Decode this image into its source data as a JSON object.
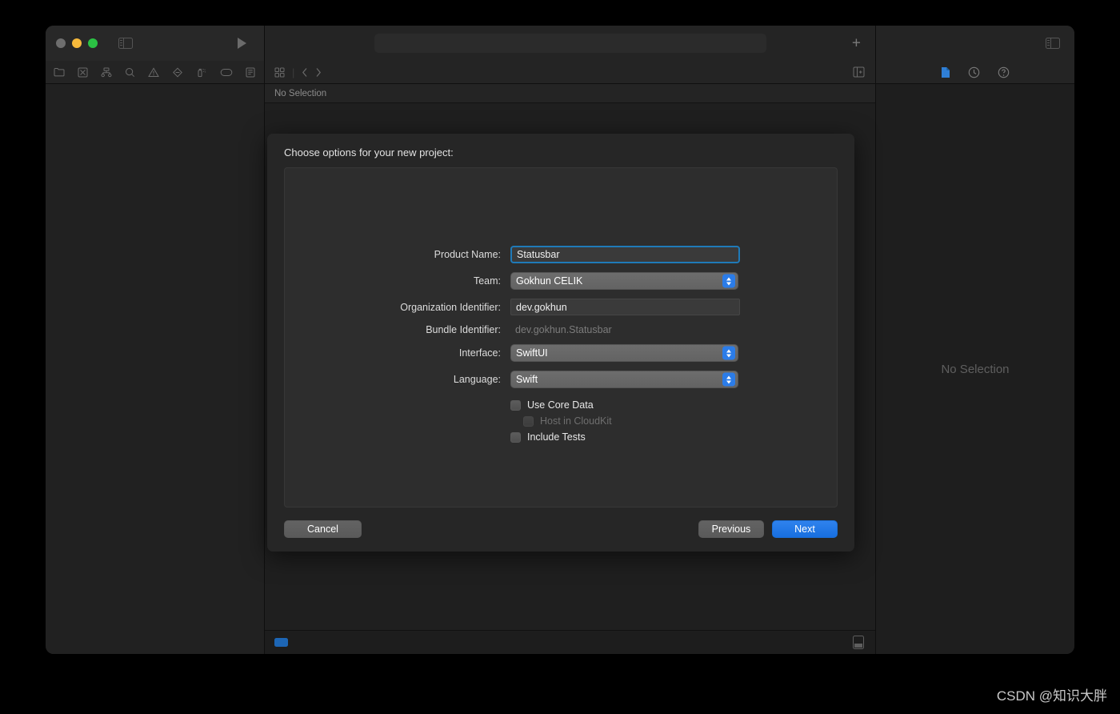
{
  "window": {
    "traffic_lights": [
      "close",
      "minimize",
      "zoom"
    ],
    "run_button": "run-button",
    "sidebar_toggle": "toggle-navigator"
  },
  "toolbar": {
    "add_label": "+",
    "activity_view_placeholder": ""
  },
  "navigator": {
    "icons": [
      "project-navigator-icon",
      "source-control-navigator-icon",
      "symbol-navigator-icon",
      "find-navigator-icon",
      "issue-navigator-icon",
      "test-navigator-icon",
      "debug-navigator-icon",
      "breakpoint-navigator-icon",
      "report-navigator-icon"
    ],
    "filter_toggle": "navigator-filter-toggle"
  },
  "editor": {
    "jump_bar": {
      "related_items_icon": "related-items-icon",
      "back_icon": "chevron-left-icon",
      "forward_icon": "chevron-right-icon",
      "assistant_icon": "assistant-editor-icon"
    },
    "breadcrumb": "No Selection"
  },
  "inspector": {
    "tabs": [
      "file-inspector-icon",
      "history-inspector-icon",
      "quick-help-icon"
    ],
    "empty_state": "No Selection"
  },
  "status_bar": {
    "activity_chip": "build-status-chip",
    "console_toggle": "console-toggle"
  },
  "sheet": {
    "title": "Choose options for your new project:",
    "fields": [
      {
        "label": "Product Name:",
        "value": "Statusbar",
        "kind": "textfield-focused",
        "name": "product-name"
      },
      {
        "label": "Team:",
        "value": "Gokhun CELIK",
        "kind": "popup",
        "name": "team"
      },
      {
        "label": "Organization Identifier:",
        "value": "dev.gokhun",
        "kind": "textfield",
        "name": "organization-identifier"
      },
      {
        "label": "Bundle Identifier:",
        "value": "dev.gokhun.Statusbar",
        "kind": "static",
        "name": "bundle-identifier"
      },
      {
        "label": "Interface:",
        "value": "SwiftUI",
        "kind": "popup",
        "name": "interface"
      },
      {
        "label": "Language:",
        "value": "Swift",
        "kind": "popup",
        "name": "language"
      }
    ],
    "checkboxes": [
      {
        "label": "Use Core Data",
        "checked": false,
        "disabled": false,
        "indent": false,
        "name": "use-core-data"
      },
      {
        "label": "Host in CloudKit",
        "checked": false,
        "disabled": true,
        "indent": true,
        "name": "host-in-cloudkit"
      },
      {
        "label": "Include Tests",
        "checked": false,
        "disabled": false,
        "indent": false,
        "name": "include-tests"
      }
    ],
    "buttons": {
      "cancel": "Cancel",
      "previous": "Previous",
      "next": "Next"
    }
  },
  "watermark": "CSDN @知识大胖",
  "colors": {
    "accent_blue": "#2b7ce8",
    "focus_ring": "#1f7ab8",
    "window_bg": "#1e1e1e",
    "sheet_bg": "#262626",
    "panel_bg": "#2d2d2d",
    "status_chip": "#1d66b5"
  }
}
